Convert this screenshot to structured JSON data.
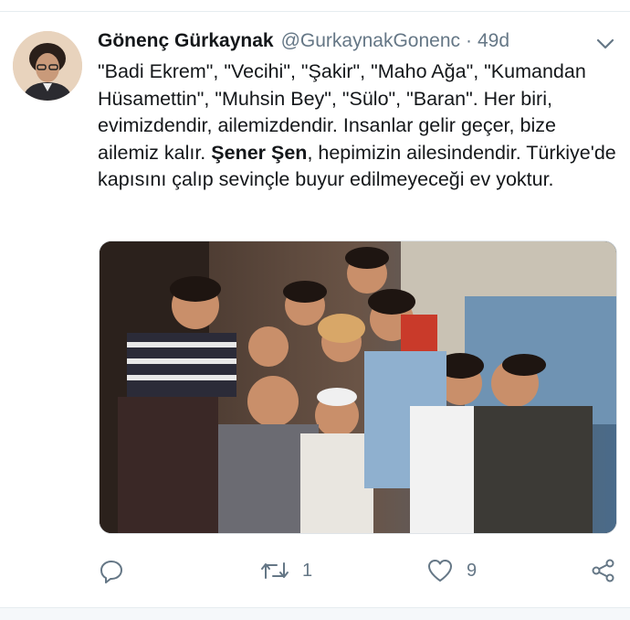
{
  "tweet": {
    "author_name": "Gönenç Gürkaynak",
    "handle": "@GurkaynakGonenc",
    "separator": "·",
    "time": "49d",
    "text_part1": "\"Badi Ekrem\", \"Vecihi\", \"Şakir\", \"Maho Ağa\", \"Kumandan Hüsamettin\", \"Muhsin Bey\", \"Sülo\", \"Baran\". Her biri, evimizdendir, ailemizdendir. Insanlar gelir geçer, bize ailemiz kalır. ",
    "text_bold": "Şener Şen",
    "text_part2": ", hepimizin ailesindendir. Türkiye'de kapısını çalıp sevinçle buyur edilmeyeceği ev yoktur.",
    "media_icon": "group-photo-image",
    "retweet_count": "1",
    "like_count": "9"
  },
  "icons": {
    "reply": "reply-icon",
    "retweet": "retweet-icon",
    "like": "heart-icon",
    "share": "share-icon",
    "menu": "chevron-down-icon"
  },
  "colors": {
    "text": "#14171a",
    "secondary": "#657786",
    "icon": "#657786",
    "border": "#e6ecf0"
  }
}
